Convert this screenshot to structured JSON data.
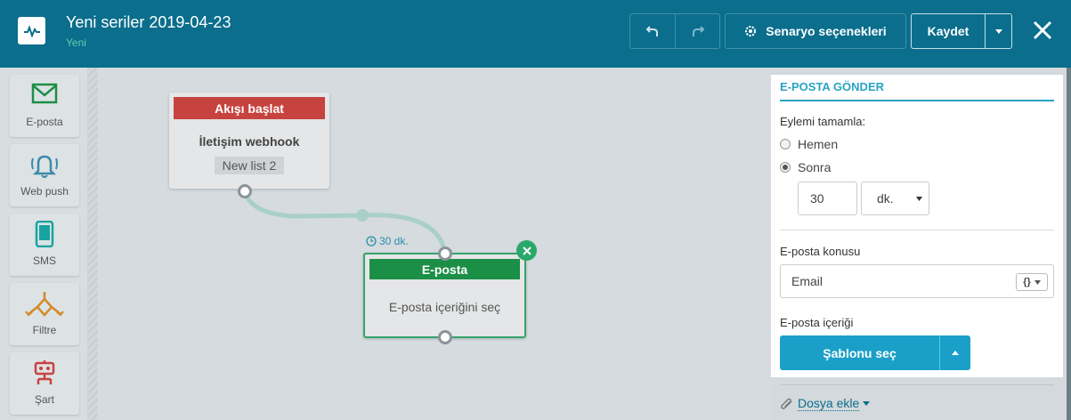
{
  "header": {
    "title": "Yeni seriler 2019-04-23",
    "subtitle": "Yeni",
    "scenario_label": "Senaryo seçenekleri",
    "save_label": "Kaydet"
  },
  "palette": {
    "items": [
      {
        "label": "E-posta",
        "icon": "envelope-icon"
      },
      {
        "label": "Web push",
        "icon": "bell-icon"
      },
      {
        "label": "SMS",
        "icon": "phone-icon"
      },
      {
        "label": "Filtre",
        "icon": "filter-icon"
      },
      {
        "label": "Şart",
        "icon": "condition-icon"
      }
    ]
  },
  "canvas": {
    "start_node": {
      "header": "Akışı başlat",
      "trigger": "İletişim webhook",
      "list": "New list 2"
    },
    "delay_label": "30 dk.",
    "email_node": {
      "header": "E-posta",
      "body": "E-posta içeriğini seç"
    }
  },
  "panel": {
    "title": "E-POSTA GÖNDER",
    "complete_label": "Eylemi tamamla:",
    "option_now": "Hemen",
    "option_later": "Sonra",
    "selected_option": "Sonra",
    "delay_value": "30",
    "delay_unit": "dk.",
    "subject_label": "E-posta konusu",
    "subject_value": "Email",
    "var_button": "{}",
    "content_label": "E-posta içeriği",
    "template_button": "Şablonu seç",
    "attach_label": "Dosya ekle"
  },
  "colors": {
    "header_bg": "#0a6e8c",
    "start_red": "#c7433f",
    "email_green": "#1c8f46",
    "accent_teal": "#2aa3c2",
    "button_blue": "#1aa0c8"
  }
}
